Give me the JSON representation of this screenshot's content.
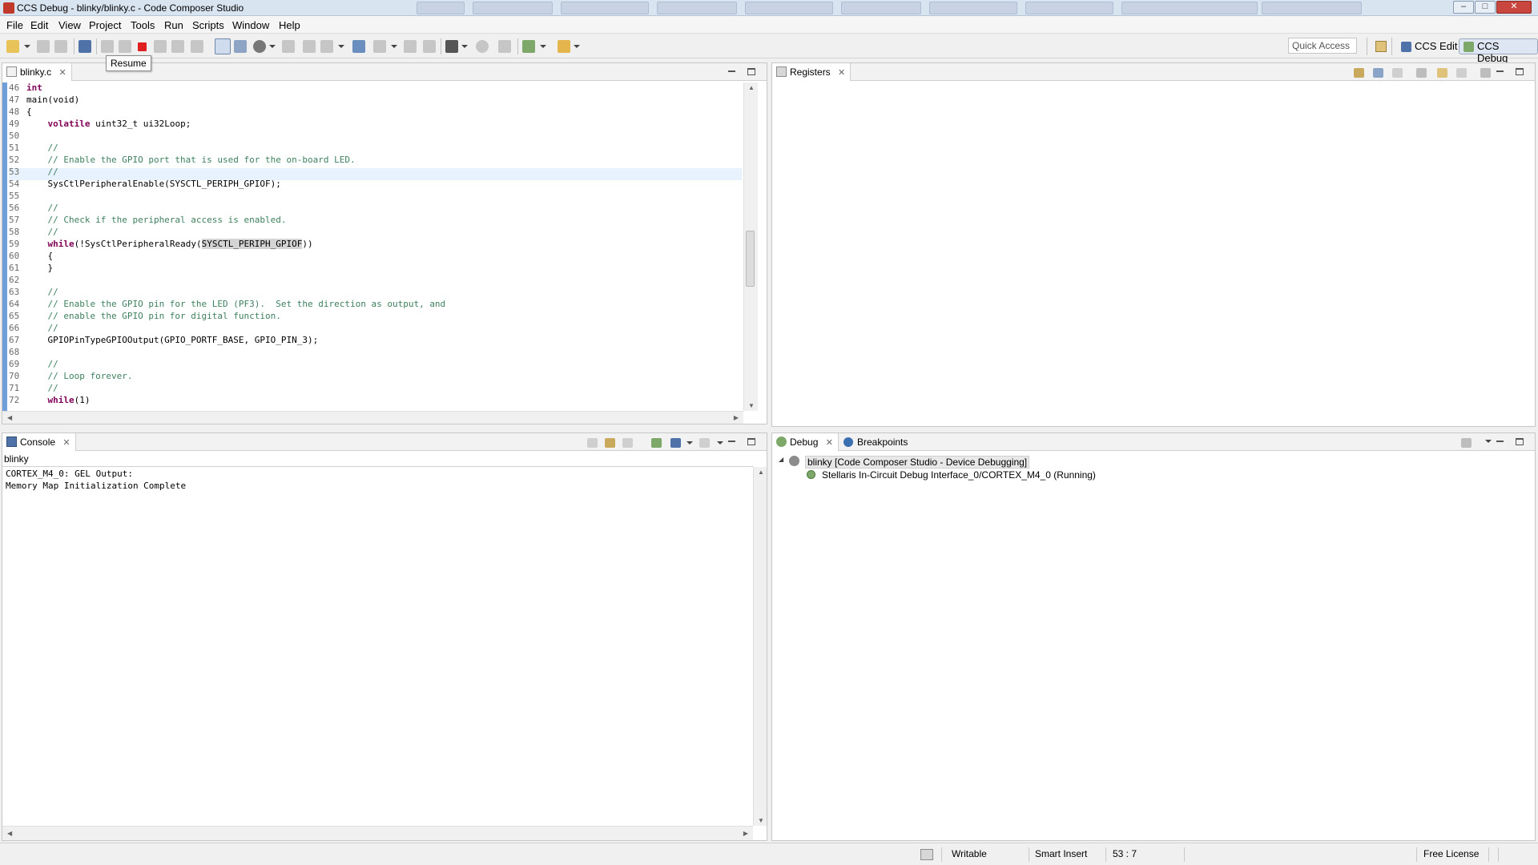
{
  "window": {
    "title": "CCS Debug - blinky/blinky.c - Code Composer Studio"
  },
  "menu": [
    "File",
    "Edit",
    "View",
    "Project",
    "Tools",
    "Run",
    "Scripts",
    "Window",
    "Help"
  ],
  "toolbar": {
    "quick_access": "Quick Access",
    "perspectives": [
      "CCS Edit",
      "CCS Debug"
    ],
    "active_perspective": "CCS Debug",
    "tooltip": "Resume",
    "terminate_color": "#e02020"
  },
  "editor": {
    "tab_label": "blinky.c",
    "current_line": "53",
    "lines": [
      {
        "n": "46",
        "text": "int"
      },
      {
        "n": "47",
        "text": "main(void)"
      },
      {
        "n": "48",
        "text": "{"
      },
      {
        "n": "49",
        "text": "    volatile uint32_t ui32Loop;"
      },
      {
        "n": "50",
        "text": ""
      },
      {
        "n": "51",
        "text": "    //"
      },
      {
        "n": "52",
        "text": "    // Enable the GPIO port that is used for the on-board LED."
      },
      {
        "n": "53",
        "text": "    //"
      },
      {
        "n": "54",
        "text": "    SysCtlPeripheralEnable(SYSCTL_PERIPH_GPIOF);"
      },
      {
        "n": "55",
        "text": ""
      },
      {
        "n": "56",
        "text": "    //"
      },
      {
        "n": "57",
        "text": "    // Check if the peripheral access is enabled."
      },
      {
        "n": "58",
        "text": "    //"
      },
      {
        "n": "59",
        "text": "    while(!SysCtlPeripheralReady(SYSCTL_PERIPH_GPIOF))"
      },
      {
        "n": "60",
        "text": "    {"
      },
      {
        "n": "61",
        "text": "    }"
      },
      {
        "n": "62",
        "text": ""
      },
      {
        "n": "63",
        "text": "    //"
      },
      {
        "n": "64",
        "text": "    // Enable the GPIO pin for the LED (PF3).  Set the direction as output, and"
      },
      {
        "n": "65",
        "text": "    // enable the GPIO pin for digital function."
      },
      {
        "n": "66",
        "text": "    //"
      },
      {
        "n": "67",
        "text": "    GPIOPinTypeGPIOOutput(GPIO_PORTF_BASE, GPIO_PIN_3);"
      },
      {
        "n": "68",
        "text": ""
      },
      {
        "n": "69",
        "text": "    //"
      },
      {
        "n": "70",
        "text": "    // Loop forever."
      },
      {
        "n": "71",
        "text": "    //"
      },
      {
        "n": "72",
        "text": "    while(1)"
      }
    ]
  },
  "registers": {
    "tab_label": "Registers"
  },
  "console": {
    "tab_label": "Console",
    "name": "blinky",
    "lines": [
      "CORTEX_M4_0: GEL Output:",
      "Memory Map Initialization Complete"
    ]
  },
  "debug": {
    "tabs": [
      "Debug",
      "Breakpoints"
    ],
    "session": "blinky [Code Composer Studio - Device Debugging]",
    "target": "Stellaris In-Circuit Debug Interface_0/CORTEX_M4_0 (Running)"
  },
  "statusbar": {
    "mode": "Writable",
    "insert": "Smart Insert",
    "position": "53 : 7",
    "license": "Free License"
  }
}
